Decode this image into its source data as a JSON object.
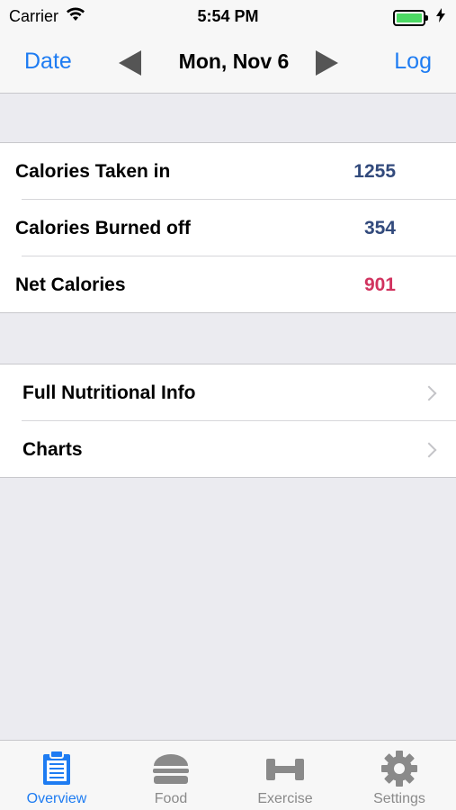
{
  "status": {
    "carrier": "Carrier",
    "time": "5:54 PM"
  },
  "nav": {
    "left_label": "Date",
    "title": "Mon, Nov 6",
    "right_label": "Log"
  },
  "summary": [
    {
      "label": "Calories Taken in",
      "value": "1255"
    },
    {
      "label": "Calories Burned off",
      "value": "354"
    },
    {
      "label": "Net Calories",
      "value": "901"
    }
  ],
  "links": [
    {
      "label": "Full Nutritional Info"
    },
    {
      "label": "Charts"
    }
  ],
  "tabs": [
    {
      "label": "Overview",
      "icon": "clipboard-icon",
      "active": true
    },
    {
      "label": "Food",
      "icon": "burger-icon"
    },
    {
      "label": "Exercise",
      "icon": "dumbbell-icon"
    },
    {
      "label": "Settings",
      "icon": "gear-icon"
    }
  ],
  "colors": {
    "accent": "#1e7cf2",
    "value_blue": "#324a7c",
    "value_pink": "#d1335f",
    "battery": "#4cd964"
  }
}
